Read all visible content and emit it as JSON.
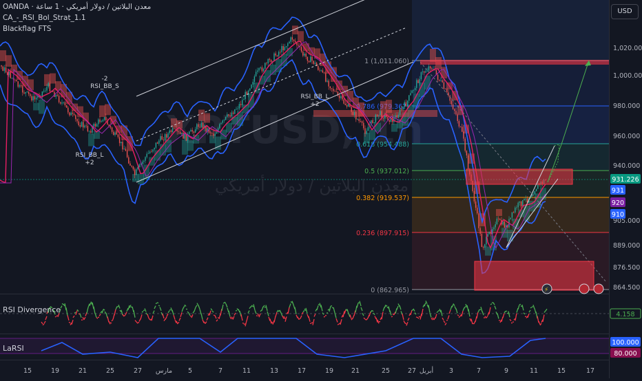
{
  "header": {
    "symbol_line": "OANDA · معدن البلاتين / دولار أمريكي · 1 ساعة",
    "indicator1": "CA_-_RSI_Bol_Strat_1.1",
    "indicator2": "Blackflag FTS"
  },
  "watermark": {
    "ticker": "XPTUSD, 1h",
    "subtitle": "معدن البلاتين / دولار أمريكي"
  },
  "currency_button": "USD",
  "price_axis": {
    "ticks": [
      "1,020.000",
      "1,000.000",
      "980.000",
      "960.000",
      "940.000",
      "905.000",
      "889.000",
      "876.500",
      "864.500"
    ]
  },
  "price_badges": [
    {
      "text": "931.226",
      "color": "#089981"
    },
    {
      "text": "931",
      "color": "#2962ff"
    },
    {
      "text": "920",
      "color": "#7b1fa2"
    },
    {
      "text": "910",
      "color": "#2962ff"
    }
  ],
  "fib_levels": [
    {
      "label": "1 (1,011.060)",
      "color": "#9598a1"
    },
    {
      "label": "0.786 (979.367)",
      "color": "#2962ff"
    },
    {
      "label": "0.618 (954.488)",
      "color": "#26a69a"
    },
    {
      "label": "0.5 (937.012)",
      "color": "#4caf50"
    },
    {
      "label": "0.382 (919.537)",
      "color": "#ff9800"
    },
    {
      "label": "0.236 (897.915)",
      "color": "#f23645"
    },
    {
      "label": "0 (862.965)",
      "color": "#9598a1"
    }
  ],
  "signals": [
    {
      "line1": "-2",
      "line2": "RSI_BB_S"
    },
    {
      "line1": "RSI_BB_L",
      "line2": "+2"
    },
    {
      "line1": "RSI_BB_L",
      "line2": "+2"
    }
  ],
  "rsi_pane": {
    "label": "RSI Divergence",
    "value": "4.158"
  },
  "larsi_pane": {
    "label": "LaRSI",
    "value_top": "100.000",
    "value_bottom": "80.000"
  },
  "time_axis": {
    "labels": [
      "15",
      "19",
      "21",
      "25",
      "27",
      "مارس",
      "5",
      "7",
      "11",
      "13",
      "17",
      "19",
      "21",
      "25",
      "27",
      "أبريل",
      "3",
      "7",
      "9",
      "11",
      "15",
      "17"
    ]
  },
  "colors": {
    "background": "#131722",
    "up": "#26a69a",
    "down": "#ef5350",
    "bollinger": "#2962ff"
  }
}
